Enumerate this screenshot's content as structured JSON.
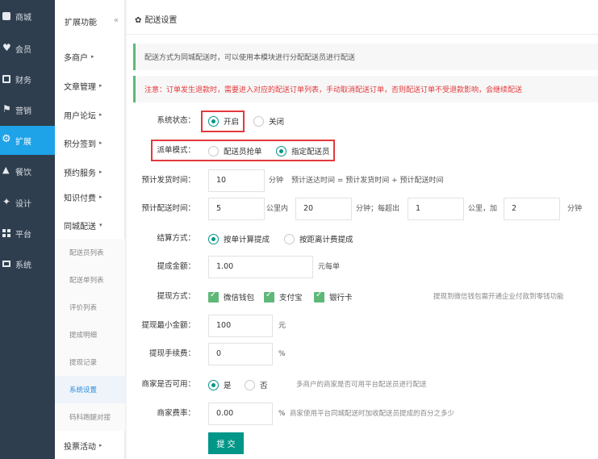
{
  "nav": {
    "items": [
      {
        "label": "商城",
        "icon": "shop-icon"
      },
      {
        "label": "会员",
        "icon": "heart-icon"
      },
      {
        "label": "财务",
        "icon": "card-icon"
      },
      {
        "label": "营销",
        "icon": "flag-icon"
      },
      {
        "label": "扩展",
        "icon": "gear-icon",
        "active": true
      },
      {
        "label": "餐饮",
        "icon": "cup-icon"
      },
      {
        "label": "设计",
        "icon": "brush-icon"
      },
      {
        "label": "平台",
        "icon": "grid-icon"
      },
      {
        "label": "系统",
        "icon": "monitor-icon"
      }
    ]
  },
  "submenu": {
    "header": "扩展功能",
    "collapse_glyph": "«",
    "items": [
      {
        "label": "多商户",
        "arrow": "▸"
      },
      {
        "label": "文章管理",
        "arrow": "▸"
      },
      {
        "label": "用户论坛",
        "arrow": "▸"
      },
      {
        "label": "积分签到",
        "arrow": "▸"
      },
      {
        "label": "预约服务",
        "arrow": "▸"
      },
      {
        "label": "知识付费",
        "arrow": "▸"
      },
      {
        "label": "同城配送",
        "arrow": "▾"
      }
    ],
    "children": [
      {
        "label": "配送员列表"
      },
      {
        "label": "配送单列表"
      },
      {
        "label": "评价列表"
      },
      {
        "label": "提成明细"
      },
      {
        "label": "提现记录"
      },
      {
        "label": "系统设置",
        "active": true
      },
      {
        "label": "码科跑腿对接"
      }
    ],
    "last_item": {
      "label": "投票活动",
      "arrow": "▸"
    }
  },
  "main": {
    "title": "配送设置",
    "title_glyph": "✿",
    "notice1": "配送方式为同城配送时，可以使用本模块进行分配配送员进行配送",
    "notice2": "注意：订单发生退款时，需要进入对应的配送订单列表，手动取消配送订单，否则配送订单不受退款影响，会继续配送",
    "form": {
      "status": {
        "label": "系统状态：",
        "options": [
          "开启",
          "关闭"
        ],
        "selected": 0
      },
      "dispatch": {
        "label": "派单模式：",
        "options": [
          "配送员抢单",
          "指定配送员"
        ],
        "selected": 1
      },
      "prep_time": {
        "label": "预计发货时间：",
        "value": "10",
        "unit": "分钟",
        "hint": "预计送达时间 = 预计发货时间 + 预计配送时间"
      },
      "delivery_time": {
        "label": "预计配送时间：",
        "value1": "5",
        "text1": "公里内",
        "value2": "20",
        "text2": "分钟；每超出",
        "value3": "1",
        "text3": "公里，加",
        "value4": "2",
        "text4": "分钟"
      },
      "settle": {
        "label": "结算方式：",
        "options": [
          "按单计算提成",
          "按距离计费提成"
        ],
        "selected": 0
      },
      "commission": {
        "label": "提成金额：",
        "value": "1.00",
        "unit": "元每单"
      },
      "withdraw_method": {
        "label": "提现方式：",
        "options": [
          "微信钱包",
          "支付宝",
          "银行卡"
        ],
        "hint": "提现到微信钱包需开通企业付款到零钱功能"
      },
      "min_withdraw": {
        "label": "提现最小金额：",
        "value": "100",
        "unit": "元"
      },
      "fee": {
        "label": "提现手续费：",
        "value": "0",
        "unit": "%"
      },
      "merchant_use": {
        "label": "商家是否可用：",
        "options": [
          "是",
          "否"
        ],
        "selected": 0,
        "hint": "多商户的商家是否可用平台配送员进行配送"
      },
      "merchant_rate": {
        "label": "商家费率：",
        "value": "0.00",
        "unit": "%",
        "hint": "商家使用平台同城配送时加收配送员提成的百分之多少"
      },
      "submit": "提 交"
    }
  },
  "colors": {
    "nav_bg": "#2f3e4e",
    "nav_active": "#1ea2e8",
    "accent": "#009688",
    "checkbox": "#5fb878",
    "warning": "#e4393c"
  }
}
